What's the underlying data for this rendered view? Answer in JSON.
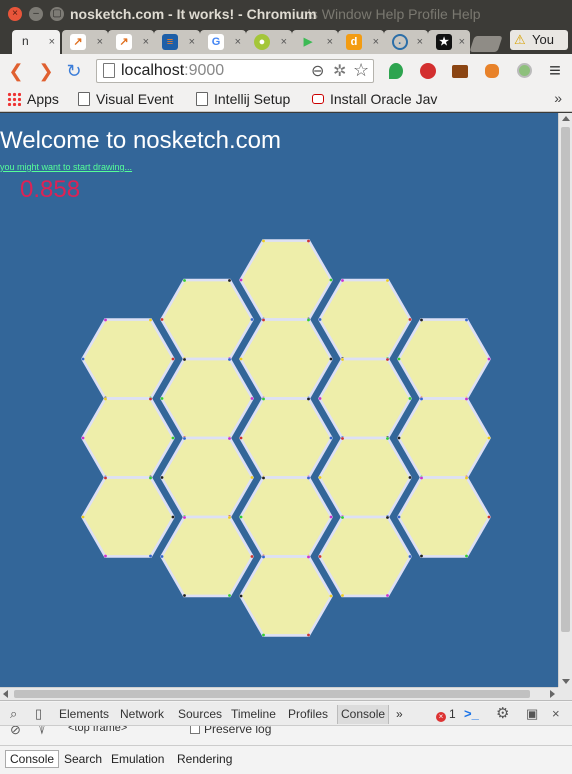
{
  "window": {
    "title": "nosketch.com - It works! - Chromium",
    "menu_ghost": "ols  Window  Help  Profile  Help",
    "close_glyph": "×",
    "min_glyph": "–",
    "max_glyph": "▢"
  },
  "tabs": [
    {
      "label": "n",
      "icon": "nosketch-favicon",
      "active": true
    },
    {
      "label": "",
      "icon": "chart-favicon"
    },
    {
      "label": "",
      "icon": "chart-favicon"
    },
    {
      "label": "",
      "icon": "stackoverflow-favicon"
    },
    {
      "label": "",
      "icon": "google-favicon"
    },
    {
      "label": "",
      "icon": "android-favicon"
    },
    {
      "label": "",
      "icon": "play-store-favicon"
    },
    {
      "label": "",
      "icon": "d-favicon"
    },
    {
      "label": "",
      "icon": "target-favicon"
    },
    {
      "label": "",
      "icon": "star-favicon"
    }
  ],
  "tab_close_glyph": "×",
  "profile": {
    "label": "You",
    "warning_glyph": "⚠"
  },
  "toolbar": {
    "back_glyph": "❮",
    "forward_glyph": "❯",
    "reload_glyph": "↻",
    "url_host": "localhost",
    "url_port": ":9000",
    "zoom_glyph": "⊖",
    "ext_glyph": "✲",
    "star_glyph": "☆",
    "menu_glyph": "≡",
    "extensions": [
      "green-leaf-icon",
      "opera-icon",
      "tv-icon",
      "fox-icon",
      "circle-icon"
    ]
  },
  "bookmarks": {
    "apps": "Apps",
    "items": [
      "Visual Event",
      "Intellij Setup",
      "Install Oracle Jav"
    ],
    "more": "»"
  },
  "page": {
    "title": "Welcome to nosketch.com",
    "link": "you might want to start drawing...",
    "score": "0.858",
    "colors": {
      "background": "#336699",
      "hex_fill": "#eeeeaa",
      "hex_border": "#dde0f5",
      "title": "#ffffff",
      "link": "#55ff99",
      "score": "#dd2255"
    },
    "hex_count": 19
  },
  "devtools": {
    "tabs": [
      "Elements",
      "Network",
      "Sources",
      "Timeline",
      "Profiles",
      "Console"
    ],
    "active_tab": "Console",
    "more": "»",
    "error_count": "1",
    "frame": "<top frame>",
    "preserve_log": "Preserve log",
    "drawer_tabs": [
      "Console",
      "Search",
      "Emulation",
      "Rendering"
    ],
    "icons": {
      "block": "⊘",
      "filter": "⍒",
      "device": "▯",
      "inspect": "⌕",
      "terminal": ">_",
      "gear": "⚙",
      "dock": "▣",
      "close": "×"
    }
  }
}
